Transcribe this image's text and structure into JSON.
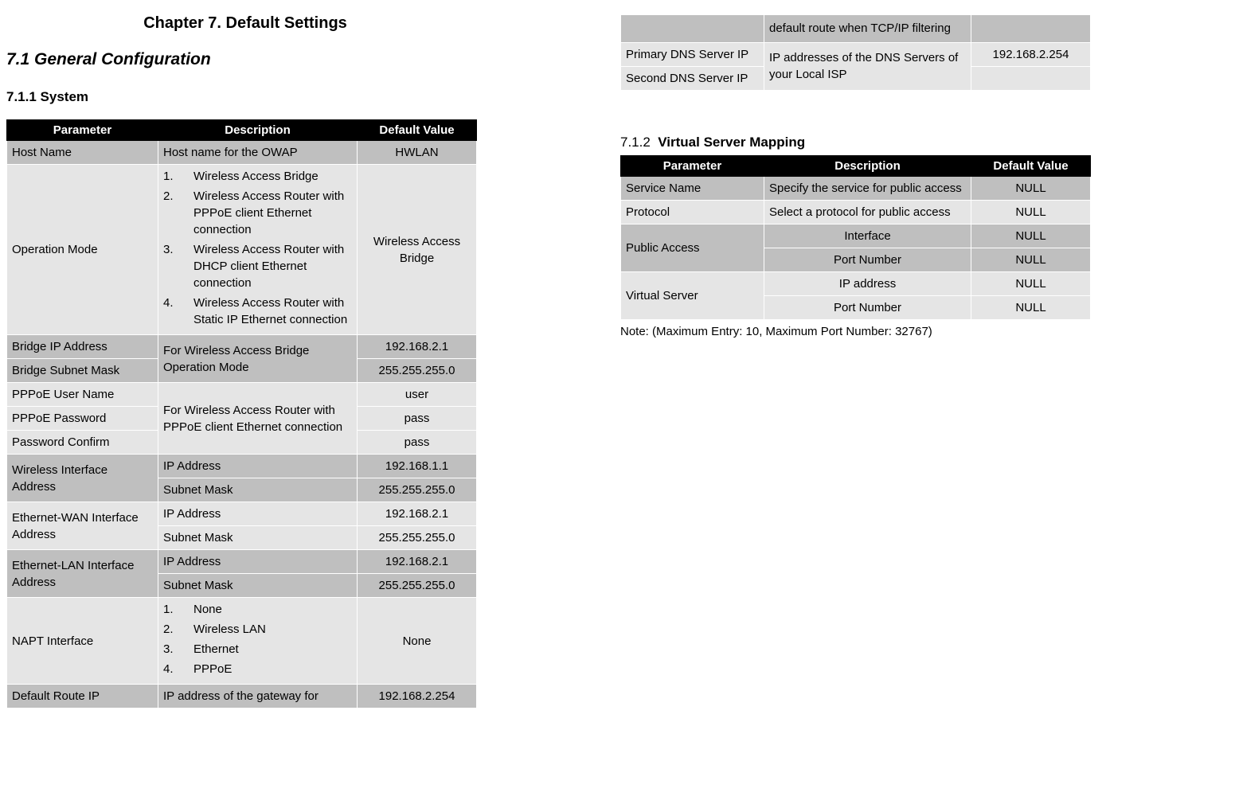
{
  "chapter": "Chapter 7.  Default Settings",
  "sec71": "7.1    General Configuration",
  "sub711": "7.1.1   System",
  "sub712_num": "7.1.2",
  "sub712_title": "Virtual Server Mapping",
  "hdr": {
    "param": "Parameter",
    "desc": "Description",
    "def": "Default Value"
  },
  "t1": {
    "hostname_p": "Host Name",
    "hostname_d": "Host name for the OWAP",
    "hostname_v": "HWLAN",
    "opmode_p": "Operation Mode",
    "op": [
      {
        "n": "1.",
        "t": "Wireless Access Bridge"
      },
      {
        "n": "2.",
        "t": "Wireless Access Router with PPPoE client Ethernet connection"
      },
      {
        "n": "3.",
        "t": "Wireless Access Router with DHCP client Ethernet connection"
      },
      {
        "n": "4.",
        "t": "Wireless Access Router with Static IP Ethernet connection"
      }
    ],
    "opmode_v": "Wireless Access Bridge",
    "bip_p": "Bridge IP Address",
    "bmask_p": "Bridge Subnet Mask",
    "bridge_d": "For Wireless Access Bridge Operation Mode",
    "bip_v": "192.168.2.1",
    "bmask_v": "255.255.255.0",
    "puser_p": "PPPoE User Name",
    "ppass_p": "PPPoE Password",
    "pconf_p": "Password Confirm",
    "pppoe_d": "For Wireless Access Router with PPPoE client Ethernet connection",
    "puser_v": "user",
    "ppass_v": "pass",
    "pconf_v": "pass",
    "wia_p": "Wireless Interface Address",
    "ip_lbl": "IP Address",
    "mask_lbl": "Subnet Mask",
    "wia_ip": "192.168.1.1",
    "wia_mask": "255.255.255.0",
    "ewan_p": "Ethernet-WAN Interface Address",
    "ewan_ip": "192.168.2.1",
    "ewan_mask": "255.255.255.0",
    "elan_p": "Ethernet-LAN Interface Address",
    "elan_ip": "192.168.2.1",
    "elan_mask": "255.255.255.0",
    "napt_p": "NAPT Interface",
    "napt": [
      {
        "n": "1.",
        "t": "None"
      },
      {
        "n": "2.",
        "t": "Wireless LAN"
      },
      {
        "n": "3.",
        "t": "Ethernet"
      },
      {
        "n": "4.",
        "t": "PPPoE"
      }
    ],
    "napt_v": "None",
    "droute_p": "Default Route IP",
    "droute_d_top": "IP address of the gateway for",
    "droute_d_bot": "default route when TCP/IP filtering",
    "droute_v": "192.168.2.254",
    "pdns_p": "Primary DNS Server IP",
    "sdns_p": "Second DNS Server IP",
    "dns_d": "IP addresses of the DNS Servers of your Local ISP",
    "pdns_v": "192.168.2.254",
    "sdns_v": ""
  },
  "t2": {
    "svc_p": "Service Name",
    "svc_d": "Specify the service for public access",
    "svc_v": "NULL",
    "proto_p": "Protocol",
    "proto_d": "Select a protocol for public access",
    "proto_v": "NULL",
    "pa_p": "Public Access",
    "if_lbl": "Interface",
    "pn_lbl": "Port Number",
    "pa_if_v": "NULL",
    "pa_pn_v": "NULL",
    "vs_p": "Virtual Server",
    "ipaddr_lbl": "IP address",
    "vs_ip_v": "NULL",
    "vs_pn_v": "NULL"
  },
  "note": "Note: (Maximum Entry: 10, Maximum Port Number: 32767)"
}
